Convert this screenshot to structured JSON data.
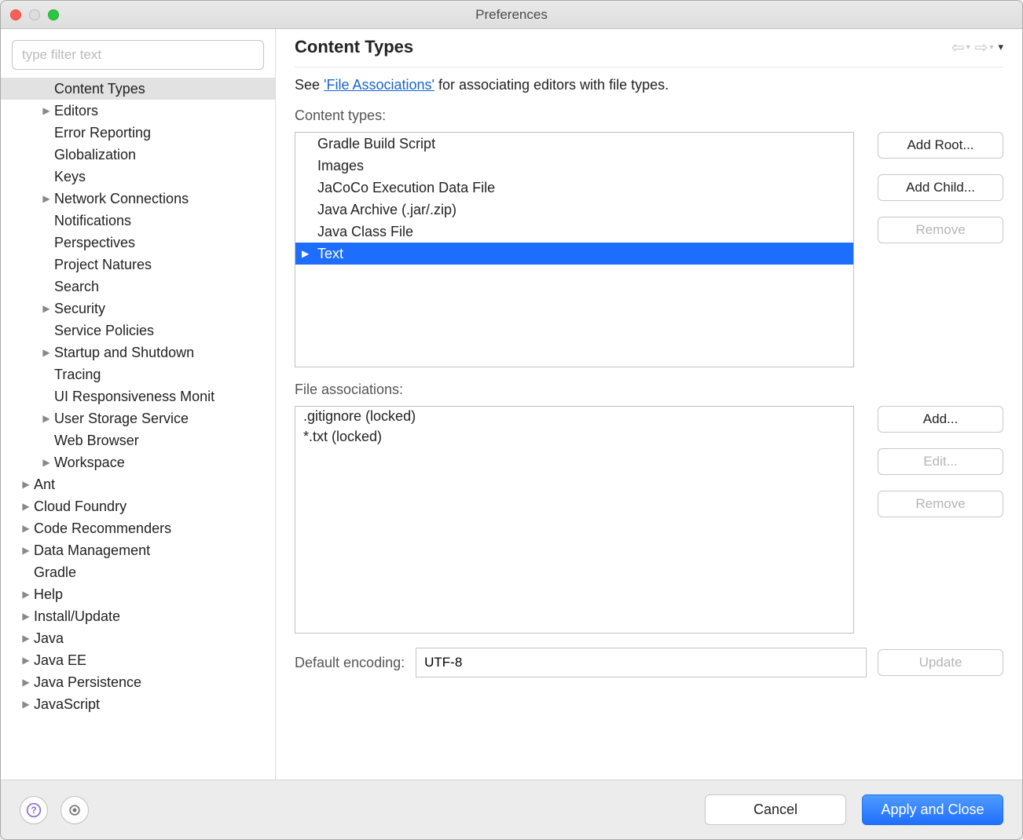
{
  "window": {
    "title": "Preferences"
  },
  "sidebar": {
    "filter_placeholder": "type filter text",
    "items": [
      {
        "label": "Content Types",
        "level": 2,
        "arrow": false,
        "selected": true
      },
      {
        "label": "Editors",
        "level": 2,
        "arrow": true
      },
      {
        "label": "Error Reporting",
        "level": 2,
        "arrow": false
      },
      {
        "label": "Globalization",
        "level": 2,
        "arrow": false
      },
      {
        "label": "Keys",
        "level": 2,
        "arrow": false
      },
      {
        "label": "Network Connections",
        "level": 2,
        "arrow": true
      },
      {
        "label": "Notifications",
        "level": 2,
        "arrow": false
      },
      {
        "label": "Perspectives",
        "level": 2,
        "arrow": false
      },
      {
        "label": "Project Natures",
        "level": 2,
        "arrow": false
      },
      {
        "label": "Search",
        "level": 2,
        "arrow": false
      },
      {
        "label": "Security",
        "level": 2,
        "arrow": true
      },
      {
        "label": "Service Policies",
        "level": 2,
        "arrow": false
      },
      {
        "label": "Startup and Shutdown",
        "level": 2,
        "arrow": true
      },
      {
        "label": "Tracing",
        "level": 2,
        "arrow": false
      },
      {
        "label": "UI Responsiveness Monit",
        "level": 2,
        "arrow": false
      },
      {
        "label": "User Storage Service",
        "level": 2,
        "arrow": true
      },
      {
        "label": "Web Browser",
        "level": 2,
        "arrow": false
      },
      {
        "label": "Workspace",
        "level": 2,
        "arrow": true
      },
      {
        "label": "Ant",
        "level": 1,
        "arrow": true
      },
      {
        "label": "Cloud Foundry",
        "level": 1,
        "arrow": true
      },
      {
        "label": "Code Recommenders",
        "level": 1,
        "arrow": true
      },
      {
        "label": "Data Management",
        "level": 1,
        "arrow": true
      },
      {
        "label": "Gradle",
        "level": 1,
        "arrow": false
      },
      {
        "label": "Help",
        "level": 1,
        "arrow": true
      },
      {
        "label": "Install/Update",
        "level": 1,
        "arrow": true
      },
      {
        "label": "Java",
        "level": 1,
        "arrow": true
      },
      {
        "label": "Java EE",
        "level": 1,
        "arrow": true
      },
      {
        "label": "Java Persistence",
        "level": 1,
        "arrow": true
      },
      {
        "label": "JavaScript",
        "level": 1,
        "arrow": true
      }
    ]
  },
  "main": {
    "title": "Content Types",
    "intro_prefix": "See ",
    "intro_link": "'File Associations'",
    "intro_suffix": " for associating editors with file types.",
    "content_types_label": "Content types:",
    "content_types": [
      {
        "label": "Gradle Build Script",
        "arrow": false
      },
      {
        "label": "Images",
        "arrow": false
      },
      {
        "label": "JaCoCo Execution Data File",
        "arrow": false
      },
      {
        "label": "Java Archive (.jar/.zip)",
        "arrow": false
      },
      {
        "label": "Java Class File",
        "arrow": false
      },
      {
        "label": "Text",
        "arrow": true,
        "selected": true
      }
    ],
    "ct_buttons": {
      "add_root": "Add Root...",
      "add_child": "Add Child...",
      "remove": "Remove"
    },
    "file_assoc_label": "File associations:",
    "file_assocs": [
      ".gitignore (locked)",
      "*.txt (locked)"
    ],
    "fa_buttons": {
      "add": "Add...",
      "edit": "Edit...",
      "remove": "Remove"
    },
    "encoding_label": "Default encoding:",
    "encoding_value": "UTF-8",
    "encoding_button": "Update"
  },
  "footer": {
    "cancel": "Cancel",
    "apply": "Apply and Close"
  }
}
